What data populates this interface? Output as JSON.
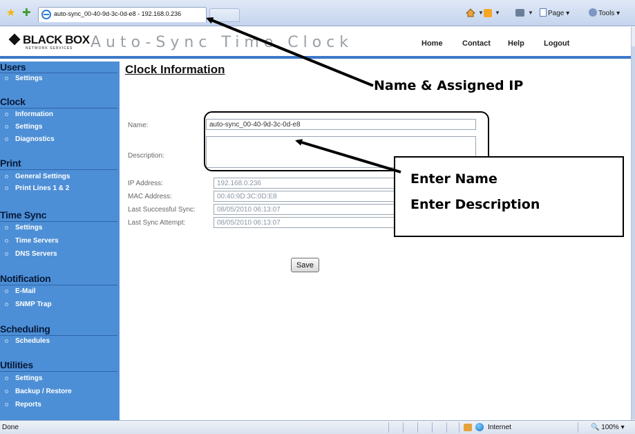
{
  "browser": {
    "tab_title": "auto-sync_00-40-9d-3c-0d-e8 - 192.168.0.236",
    "page_menu": "Page",
    "tools_menu": "Tools",
    "status_text": "Done",
    "zone": "Internet",
    "zoom": "100%"
  },
  "header": {
    "logo_text": "BLACK BOX",
    "logo_subtext": "NETWORK SERVICES",
    "app_title": "Auto-Sync Time Clock",
    "nav": [
      "Home",
      "Contact",
      "Help",
      "Logout"
    ]
  },
  "sidebar": {
    "groups": [
      {
        "title": "Users",
        "items": [
          "Settings"
        ]
      },
      {
        "title": "Clock",
        "items": [
          "Information",
          "Settings",
          "Diagnostics"
        ]
      },
      {
        "title": "Print",
        "items": [
          "General Settings",
          "Print Lines 1 & 2"
        ]
      },
      {
        "title": "Time Sync",
        "items": [
          "Settings",
          "Time Servers",
          "DNS Servers"
        ]
      },
      {
        "title": "Notification",
        "items": [
          "E-Mail",
          "SNMP Trap"
        ]
      },
      {
        "title": "Scheduling",
        "items": [
          "Schedules"
        ]
      },
      {
        "title": "Utilities",
        "items": [
          "Settings",
          "Backup / Restore",
          "Reports"
        ]
      }
    ]
  },
  "main": {
    "heading": "Clock Information",
    "name_label": "Name:",
    "name_value": "auto-sync_00-40-9d-3c-0d-e8",
    "description_label": "Description:",
    "description_value": "",
    "ip_label": "IP Address:",
    "ip_value": "192.168.0.236",
    "mac_label": "MAC Address:",
    "mac_value": "00:40:9D:3C:0D:E8",
    "last_success_label": "Last Successful Sync:",
    "last_success_value": "08/05/2010 06:13:07",
    "last_attempt_label": "Last Sync Attempt:",
    "last_attempt_value": "08/05/2010 06:13:07",
    "save_label": "Save"
  },
  "callouts": {
    "name_ip": "Name & Assigned IP",
    "enter_name": "Enter Name",
    "enter_description": "Enter Description"
  }
}
